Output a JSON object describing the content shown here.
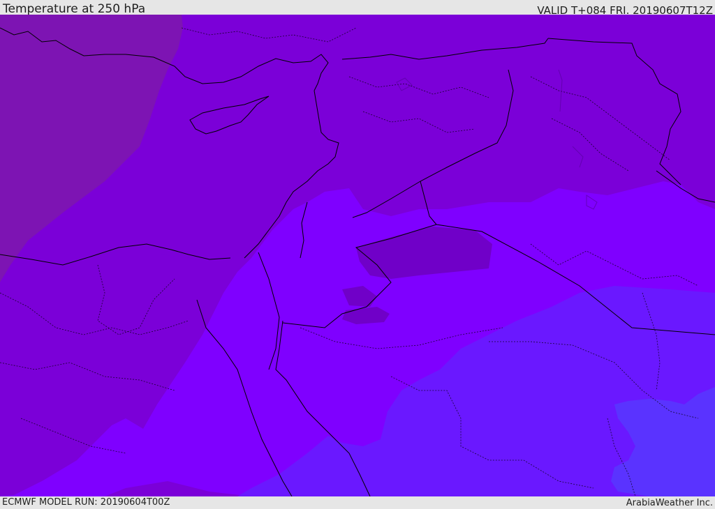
{
  "header": {
    "title": "Temperature at 250 hPa",
    "valid": "VALID T+084 FRI. 20190607T12Z"
  },
  "footer": {
    "model_run": "ECMWF MODEL RUN: 20190604T00Z",
    "brand": "ArabiaWeather Inc."
  },
  "map": {
    "colors": {
      "band_warmest": "#7d14b3",
      "band_warm": "#7b00d8",
      "band_mid": "#7f00ff",
      "band_cool": "#6a18ff",
      "band_coolest": "#5a33ff",
      "patch_dark": "#7000c8",
      "border_line": "#000000"
    }
  }
}
